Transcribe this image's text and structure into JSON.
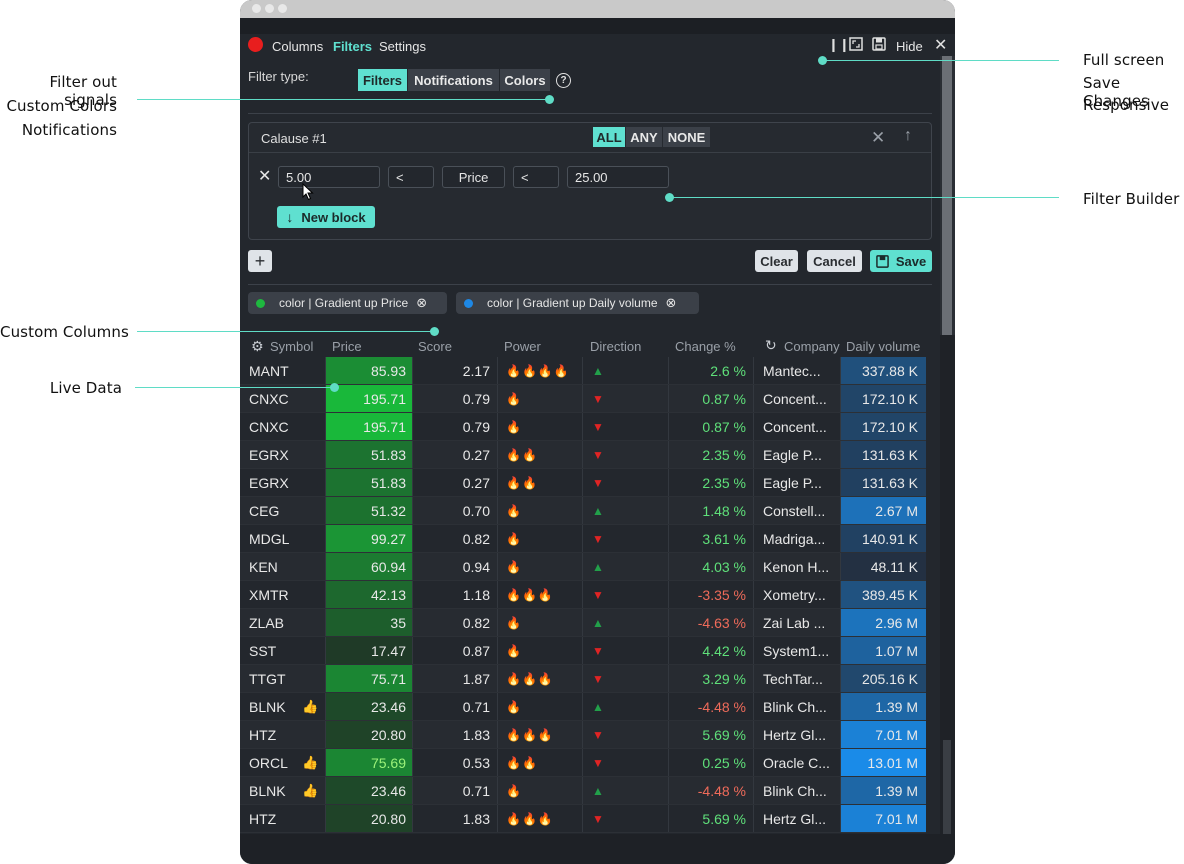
{
  "annotations": {
    "left": [
      "Filter out signals",
      "Custom Colors",
      "Notifications",
      "Custom Columns",
      "Live Data"
    ],
    "right": [
      "Full screen",
      "Save Changes",
      "Responsive",
      "Filter Builder"
    ]
  },
  "menu": {
    "columns": "Columns",
    "filters": "Filters",
    "settings": "Settings",
    "hide": "Hide"
  },
  "filter_type": {
    "label": "Filter type:",
    "options": [
      "Filters",
      "Notifications",
      "Colors"
    ],
    "selected": "Filters"
  },
  "clause": {
    "title": "Calause #1",
    "modes": [
      "ALL",
      "ANY",
      "NONE"
    ],
    "selected_mode": "ALL",
    "min_value": "5.00",
    "op1": "<",
    "field": "Price",
    "op2": "<",
    "max_value": "25.00",
    "new_block": "New block"
  },
  "actions": {
    "clear": "Clear",
    "cancel": "Cancel",
    "save": "Save"
  },
  "color_tags": [
    {
      "label": "color | Gradient up Price",
      "dot_color": "#1eb83f"
    },
    {
      "label": "color | Gradient up Daily volume",
      "dot_color": "#1e88e5"
    }
  ],
  "table": {
    "columns": [
      "Symbol",
      "Price",
      "Score",
      "Power",
      "Direction",
      "Change %",
      "Company",
      "Daily volume"
    ],
    "rows": [
      {
        "symbol": "MANT",
        "thumb": false,
        "price": "85.93",
        "score": "2.17",
        "power": 4,
        "dir": "up",
        "change": "2.6 %",
        "company": "Mantec...",
        "volume": "337.88 K"
      },
      {
        "symbol": "CNXC",
        "thumb": false,
        "price": "195.71",
        "score": "0.79",
        "power": 1,
        "dir": "down",
        "change": "0.87 %",
        "company": "Concent...",
        "volume": "172.10 K"
      },
      {
        "symbol": "CNXC",
        "thumb": false,
        "price": "195.71",
        "score": "0.79",
        "power": 1,
        "dir": "down",
        "change": "0.87 %",
        "company": "Concent...",
        "volume": "172.10 K"
      },
      {
        "symbol": "EGRX",
        "thumb": false,
        "price": "51.83",
        "score": "0.27",
        "power": 2,
        "dir": "down",
        "change": "2.35 %",
        "company": "Eagle P...",
        "volume": "131.63 K"
      },
      {
        "symbol": "EGRX",
        "thumb": false,
        "price": "51.83",
        "score": "0.27",
        "power": 2,
        "dir": "down",
        "change": "2.35 %",
        "company": "Eagle P...",
        "volume": "131.63 K"
      },
      {
        "symbol": "CEG",
        "thumb": false,
        "price": "51.32",
        "score": "0.70",
        "power": 1,
        "dir": "up",
        "change": "1.48 %",
        "company": "Constell...",
        "volume": "2.67 M"
      },
      {
        "symbol": "MDGL",
        "thumb": false,
        "price": "99.27",
        "score": "0.82",
        "power": 1,
        "dir": "down",
        "change": "3.61 %",
        "company": "Madriga...",
        "volume": "140.91 K"
      },
      {
        "symbol": "KEN",
        "thumb": false,
        "price": "60.94",
        "score": "0.94",
        "power": 1,
        "dir": "up",
        "change": "4.03 %",
        "company": "Kenon H...",
        "volume": "48.11 K"
      },
      {
        "symbol": "XMTR",
        "thumb": false,
        "price": "42.13",
        "score": "1.18",
        "power": 3,
        "dir": "down",
        "change": "-3.35 %",
        "company": "Xometry...",
        "volume": "389.45 K"
      },
      {
        "symbol": "ZLAB",
        "thumb": false,
        "price": "35",
        "score": "0.82",
        "power": 1,
        "dir": "up",
        "change": "-4.63 %",
        "company": "Zai Lab ...",
        "volume": "2.96 M"
      },
      {
        "symbol": "SST",
        "thumb": false,
        "price": "17.47",
        "score": "0.87",
        "power": 1,
        "dir": "down",
        "change": "4.42 %",
        "company": "System1...",
        "volume": "1.07 M"
      },
      {
        "symbol": "TTGT",
        "thumb": false,
        "price": "75.71",
        "score": "1.87",
        "power": 3,
        "dir": "down",
        "change": "3.29 %",
        "company": "TechTar...",
        "volume": "205.16 K"
      },
      {
        "symbol": "BLNK",
        "thumb": true,
        "price": "23.46",
        "score": "0.71",
        "power": 1,
        "dir": "up",
        "change": "-4.48 %",
        "company": "Blink Ch...",
        "volume": "1.39 M"
      },
      {
        "symbol": "HTZ",
        "thumb": false,
        "price": "20.80",
        "score": "1.83",
        "power": 3,
        "dir": "down",
        "change": "5.69 %",
        "company": "Hertz Gl...",
        "volume": "7.01 M"
      },
      {
        "symbol": "ORCL",
        "thumb": true,
        "price": "75.69",
        "score": "0.53",
        "power": 2,
        "dir": "down",
        "change": "0.25 %",
        "company": "Oracle C...",
        "volume": "13.01 M"
      },
      {
        "symbol": "BLNK",
        "thumb": true,
        "price": "23.46",
        "score": "0.71",
        "power": 1,
        "dir": "up",
        "change": "-4.48 %",
        "company": "Blink Ch...",
        "volume": "1.39 M"
      },
      {
        "symbol": "HTZ",
        "thumb": false,
        "price": "20.80",
        "score": "1.83",
        "power": 3,
        "dir": "down",
        "change": "5.69 %",
        "company": "Hertz Gl...",
        "volume": "7.01 M"
      }
    ]
  },
  "icons": {
    "record": "record-dot-icon",
    "pause": "pause-icon",
    "fullscreen": "fullscreen-icon",
    "save": "save-icon",
    "close": "close-icon",
    "help": "help-icon",
    "remove": "remove-condition-icon",
    "arrow_down": "arrow-down-icon",
    "arrow_up": "arrow-up-icon",
    "add": "add-clause-icon",
    "gear": "gear-icon",
    "refresh": "refresh-icon",
    "thumb": "thumb-up-icon",
    "fire": "fire-icon"
  },
  "colors": {
    "accent": "#5fe0d0",
    "window_bg": "#23272d",
    "annotation_line": "#5fdcc6",
    "up": "#22a04a",
    "down": "#e02424",
    "positive_text": "#5fe07a",
    "negative_text": "#ef6b5a"
  }
}
